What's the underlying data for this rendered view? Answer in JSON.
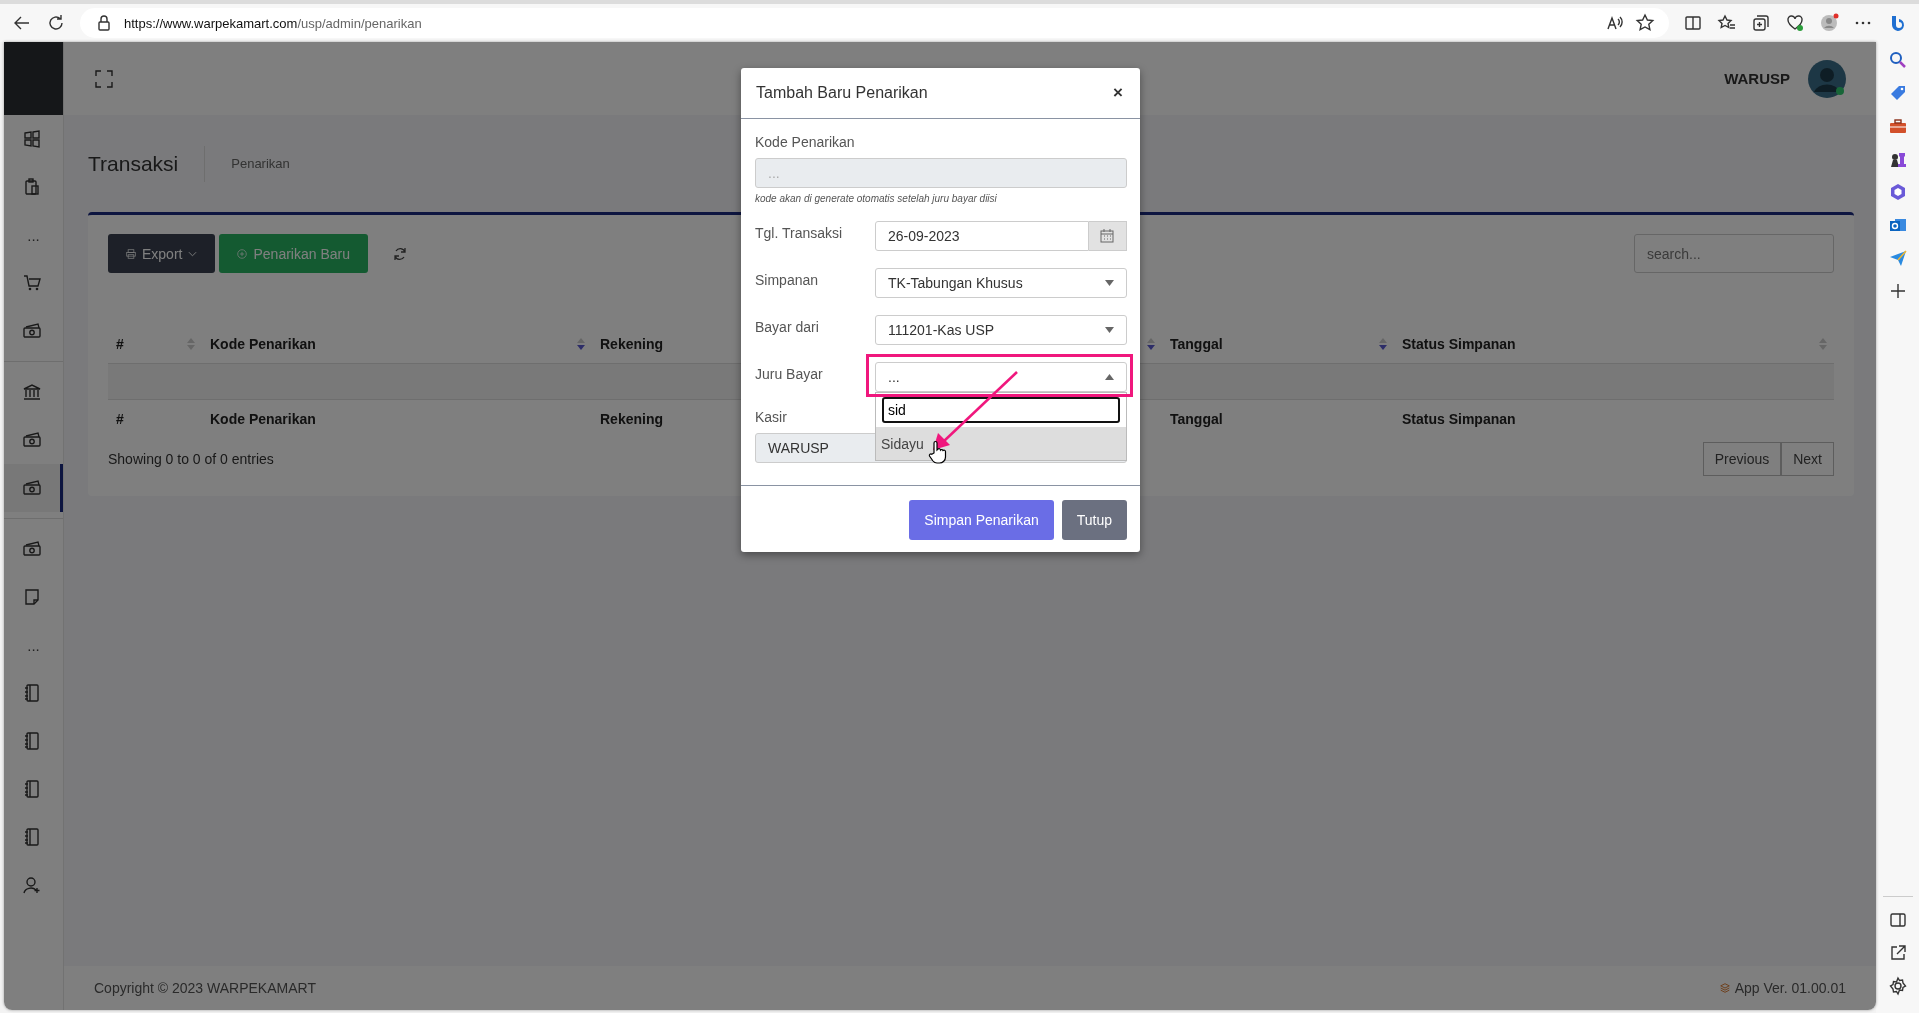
{
  "browser": {
    "url_host": "https://www.warpekamart.com",
    "url_path": "/usp/admin/penarikan"
  },
  "sidebar": {
    "items": [
      {
        "kind": "icon",
        "selected": false
      },
      {
        "kind": "icon",
        "selected": false
      },
      {
        "kind": "ellipsis",
        "label": "..."
      },
      {
        "kind": "icon",
        "selected": false
      },
      {
        "kind": "icon",
        "selected": false
      },
      {
        "kind": "divider"
      },
      {
        "kind": "icon",
        "selected": false
      },
      {
        "kind": "icon",
        "selected": false
      },
      {
        "kind": "icon",
        "selected": true
      },
      {
        "kind": "divider"
      },
      {
        "kind": "icon",
        "selected": false
      },
      {
        "kind": "icon",
        "selected": false
      },
      {
        "kind": "ellipsis",
        "label": "..."
      },
      {
        "kind": "icon",
        "selected": false
      },
      {
        "kind": "icon",
        "selected": false
      },
      {
        "kind": "icon",
        "selected": false
      },
      {
        "kind": "icon",
        "selected": false
      },
      {
        "kind": "icon",
        "selected": false
      }
    ]
  },
  "header": {
    "user_name": "WARUSP"
  },
  "breadcrumb": {
    "title": "Transaksi",
    "current": "Penarikan"
  },
  "toolbar": {
    "buttons": [
      {
        "label": "Export",
        "kind": "export"
      },
      {
        "label": "Penarikan Baru",
        "kind": "add"
      }
    ],
    "search": {
      "placeholder": "search..."
    }
  },
  "table": {
    "columns": [
      {
        "label": "#",
        "sorted": false
      },
      {
        "label": "Kode Penarikan",
        "sorted": true
      },
      {
        "label": "Rekening",
        "sorted": true
      },
      {
        "label": "Tanggal",
        "sorted": true
      },
      {
        "label": "Status Simpanan",
        "sorted": false
      }
    ],
    "footer_columns": [
      "#",
      "Kode Penarikan",
      "Rekening",
      "Tanggal",
      "Status Simpanan"
    ],
    "info": "Showing 0 to 0 of 0 entries",
    "pagination": [
      "Previous",
      "Next"
    ]
  },
  "footer": {
    "copyright": "Copyright © 2023 WARPEKAMART",
    "version": "App Ver. 01.00.01"
  },
  "modal": {
    "title": "Tambah Baru Penarikan",
    "close": "×",
    "fields": [
      {
        "kind": "stacked",
        "label": "Kode Penarikan",
        "placeholder": "...",
        "disabled": true,
        "hint": "kode akan di generate otomatis setelah juru bayar diisi"
      },
      {
        "kind": "date",
        "label": "Tgl. Transaksi",
        "value": "26-09-2023"
      },
      {
        "kind": "select",
        "label": "Simpanan",
        "value": "TK-Tabungan Khusus",
        "expanded": false,
        "highlighted": false
      },
      {
        "kind": "select",
        "label": "Bayar dari",
        "value": "111201-Kas USP",
        "expanded": false,
        "highlighted": false
      },
      {
        "kind": "select",
        "label": "Juru Bayar",
        "value": "...",
        "expanded": true,
        "highlighted": true,
        "search": "sid",
        "options": [
          {
            "label": "Sidayu",
            "selected": true
          }
        ]
      },
      {
        "kind": "stacked",
        "label": "Kasir",
        "value": "WARUSP",
        "disabled": true
      }
    ],
    "buttons": [
      {
        "label": "Simpan Penarikan",
        "kind": "primary"
      },
      {
        "label": "Tutup",
        "kind": "secondary"
      }
    ]
  }
}
